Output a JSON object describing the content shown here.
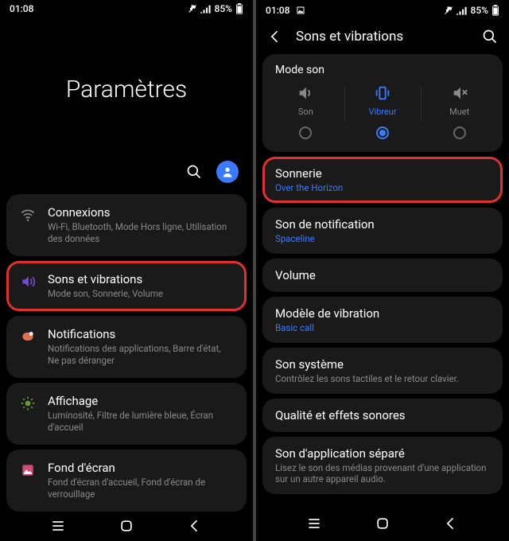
{
  "status": {
    "time": "01:08",
    "battery": "85%"
  },
  "left": {
    "title": "Paramètres",
    "items": [
      {
        "title": "Connexions",
        "sub": "Wi-Fi, Bluetooth, Mode Hors ligne, Utilisation des données",
        "icon": "wifi-icon"
      },
      {
        "title": "Sons et vibrations",
        "sub": "Mode son, Sonnerie, Volume",
        "icon": "speaker-icon",
        "highlight": true
      },
      {
        "title": "Notifications",
        "sub": "Notifications des applications, Barre d'état, Ne pas déranger",
        "icon": "notification-icon"
      },
      {
        "title": "Affichage",
        "sub": "Luminosité, Filtre de lumière bleue, Écran d'accueil",
        "icon": "brightness-icon"
      },
      {
        "title": "Fond d'écran",
        "sub": "Fond d'écran d'accueil, Fond d'écran de verrouillage",
        "icon": "wallpaper-icon"
      }
    ]
  },
  "right": {
    "title": "Sons et vibrations",
    "mode": {
      "title": "Mode son",
      "options": [
        {
          "label": "Son",
          "icon": "sound-icon"
        },
        {
          "label": "Vibreur",
          "icon": "vibrate-icon",
          "active": true
        },
        {
          "label": "Muet",
          "icon": "mute-icon"
        }
      ]
    },
    "items": [
      {
        "title": "Sonnerie",
        "sub": "Over the Horizon",
        "subcolor": "blue",
        "highlight": true
      },
      {
        "title": "Son de notification",
        "sub": "Spaceline",
        "subcolor": "blue"
      },
      {
        "title": "Volume"
      },
      {
        "title": "Modèle de vibration",
        "sub": "Basic call",
        "subcolor": "blue"
      },
      {
        "title": "Son système",
        "sub": "Contrôlez les sons tactiles et le retour clavier.",
        "subcolor": "gray"
      },
      {
        "title": "Qualité et effets sonores"
      },
      {
        "title": "Son d'application séparé",
        "sub": "Lisez le son des médias provenant d'une application sur un autre appareil audio.",
        "subcolor": "gray"
      }
    ]
  }
}
